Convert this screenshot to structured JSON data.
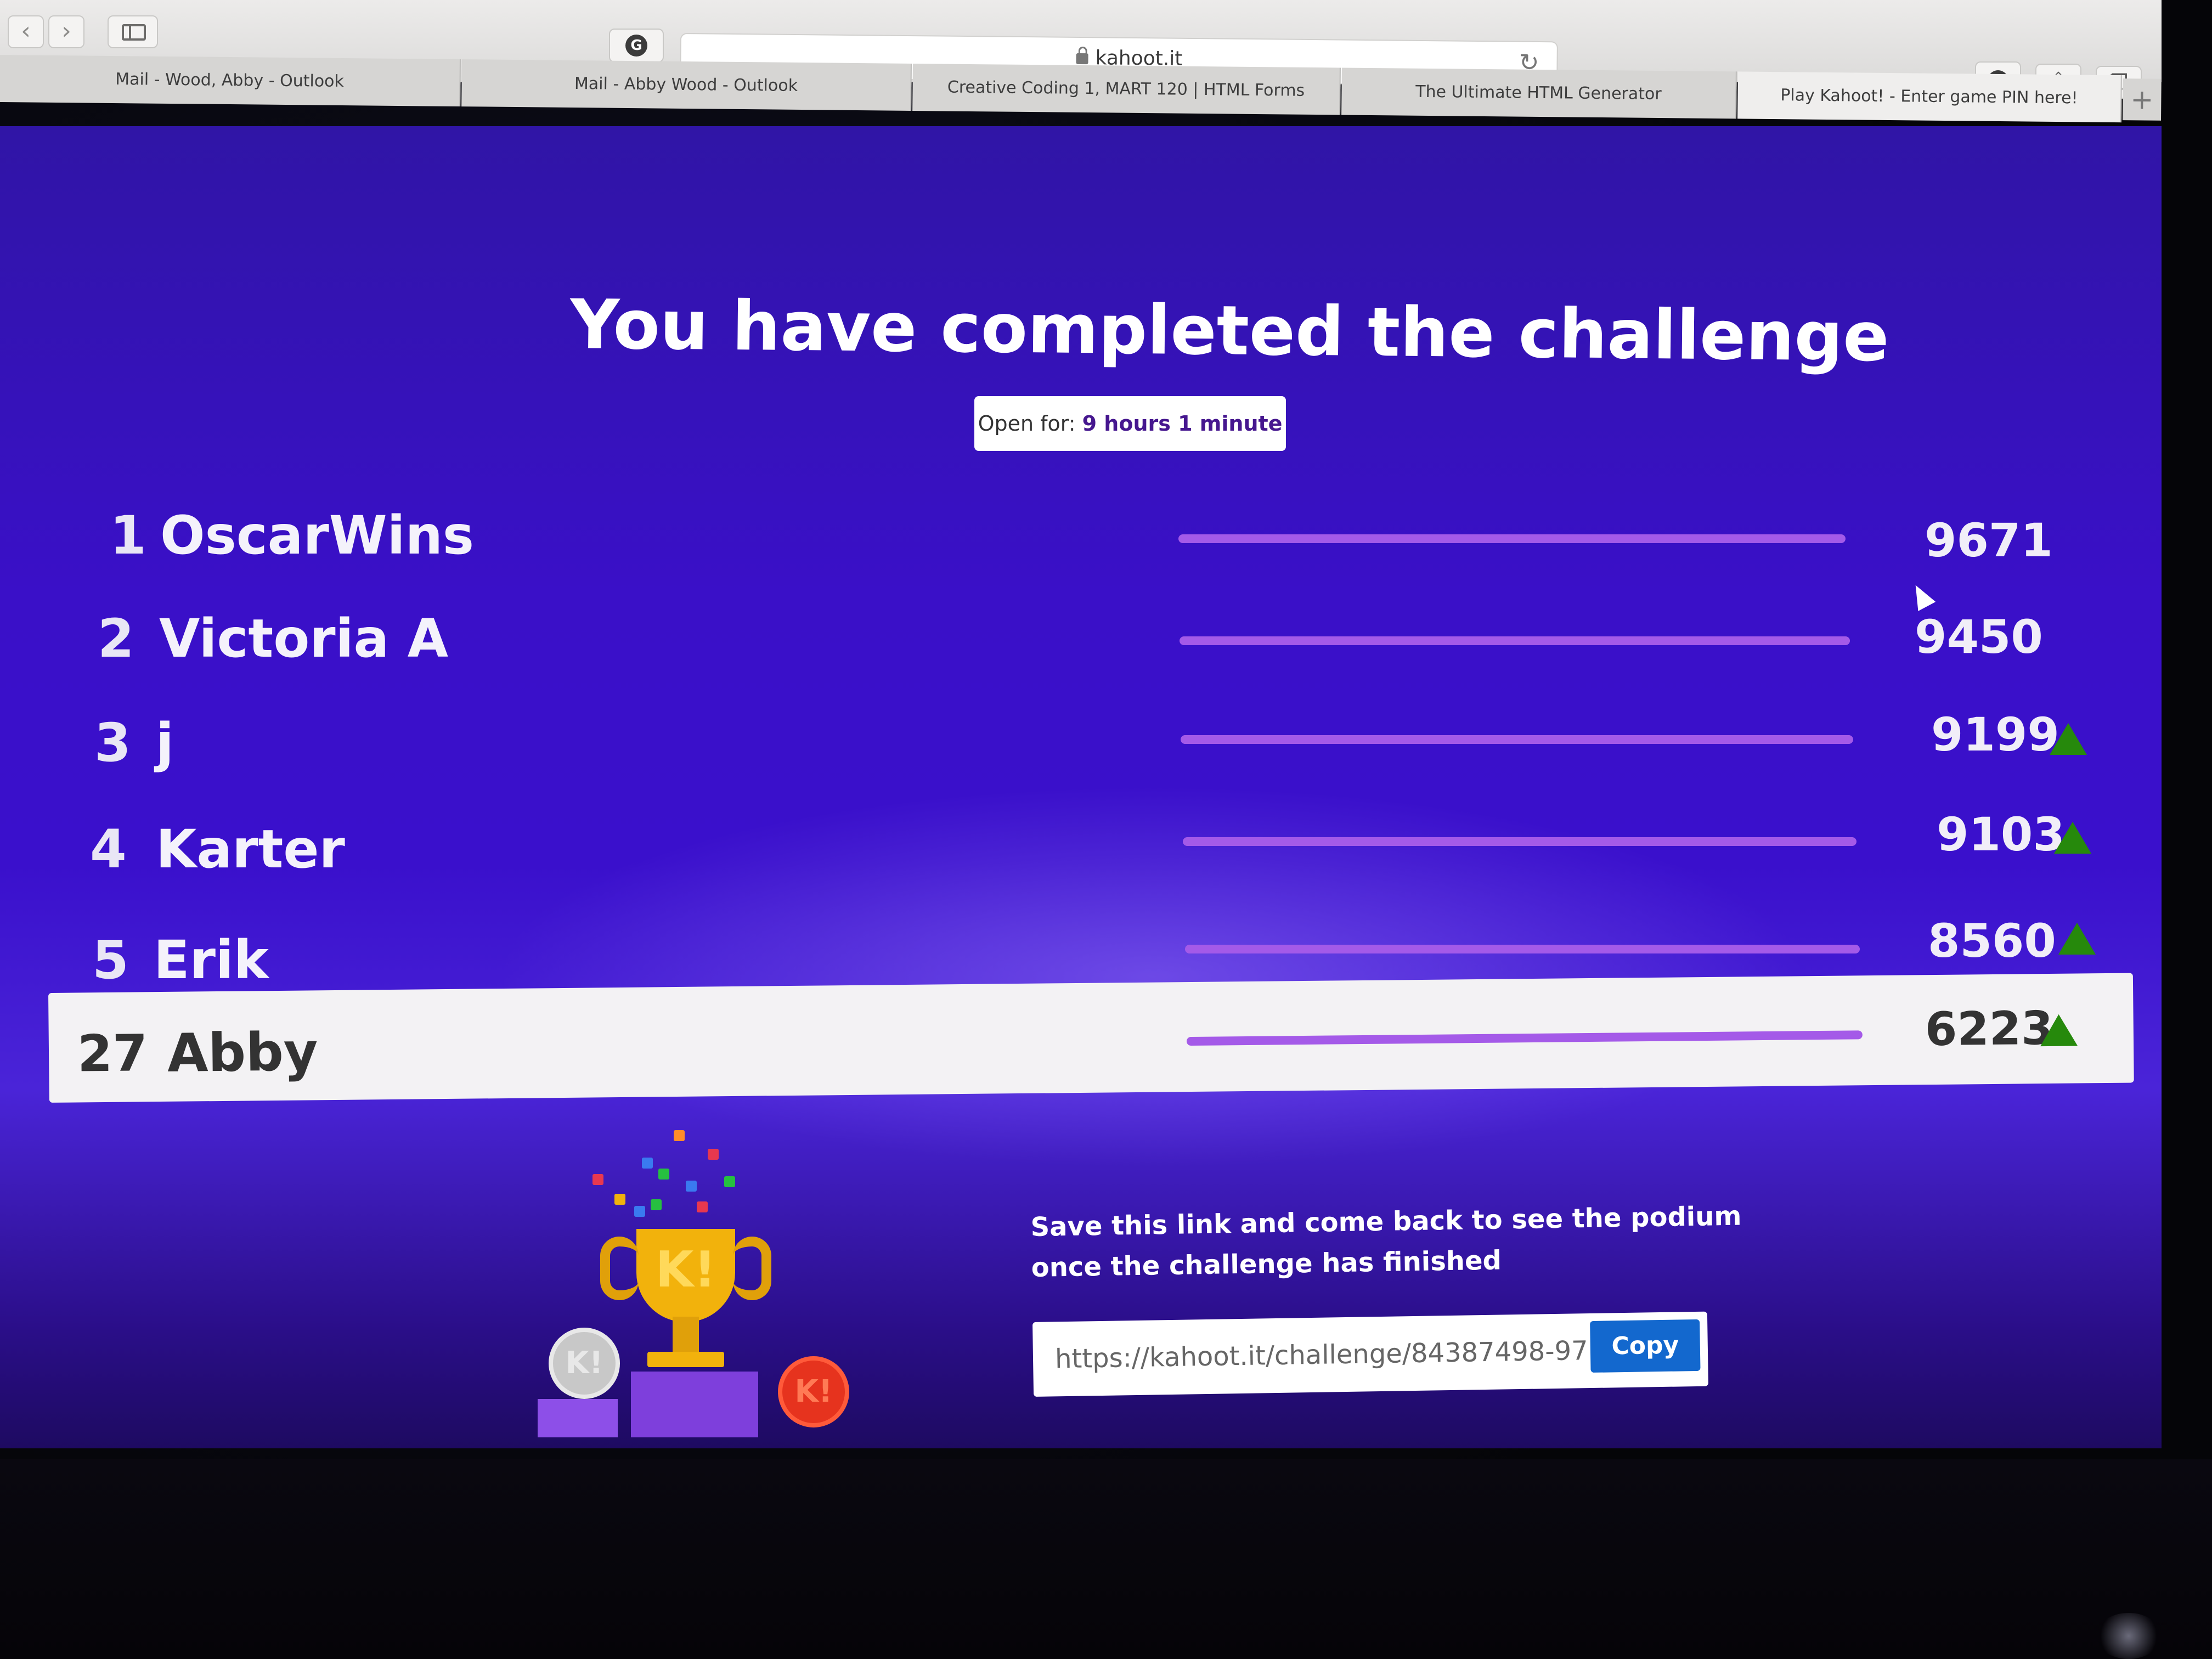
{
  "browser": {
    "address": "kahoot.it",
    "tabs": [
      {
        "label": "Mail - Wood, Abby - Outlook",
        "active": false
      },
      {
        "label": "Mail - Abby Wood - Outlook",
        "active": false
      },
      {
        "label": "Creative Coding 1, MART 120 | HTML Forms",
        "active": false
      },
      {
        "label": "The Ultimate HTML Generator",
        "active": false
      },
      {
        "label": "Play Kahoot! - Enter game PIN here!",
        "active": true
      }
    ],
    "icons": {
      "back": "chevron-left-icon",
      "forward": "chevron-right-icon",
      "sidebar": "sidebar-icon",
      "extension": "grammarly-icon",
      "reload": "reload-icon",
      "download": "download-icon",
      "share": "share-icon",
      "tabs": "tabs-overview-icon",
      "new_tab": "plus-icon"
    }
  },
  "page": {
    "title": "You have completed the challenge",
    "open_for_label": "Open for:",
    "open_for_value": "9 hours 1 minute",
    "leaderboard": [
      {
        "rank": "1",
        "name": "OscarWins",
        "score": "9671",
        "trend": "none"
      },
      {
        "rank": "2",
        "name": "Victoria A",
        "score": "9450",
        "trend": "none"
      },
      {
        "rank": "3",
        "name": "j",
        "score": "9199",
        "trend": "up"
      },
      {
        "rank": "4",
        "name": "Karter",
        "score": "9103",
        "trend": "up"
      },
      {
        "rank": "5",
        "name": "Erik",
        "score": "8560",
        "trend": "up"
      }
    ],
    "current_player": {
      "rank": "27",
      "name": "Abby",
      "score": "6223",
      "trend": "up"
    },
    "footer": {
      "message": "Save this link and come back to see the podium once the challenge has finished",
      "link": "https://kahoot.it/challenge/84387498-97...",
      "copy_label": "Copy"
    }
  },
  "colors": {
    "background": "#3a10c8",
    "bar": "#a45ae8",
    "trend_up": "#26890c",
    "copy_button": "#1368ce"
  }
}
